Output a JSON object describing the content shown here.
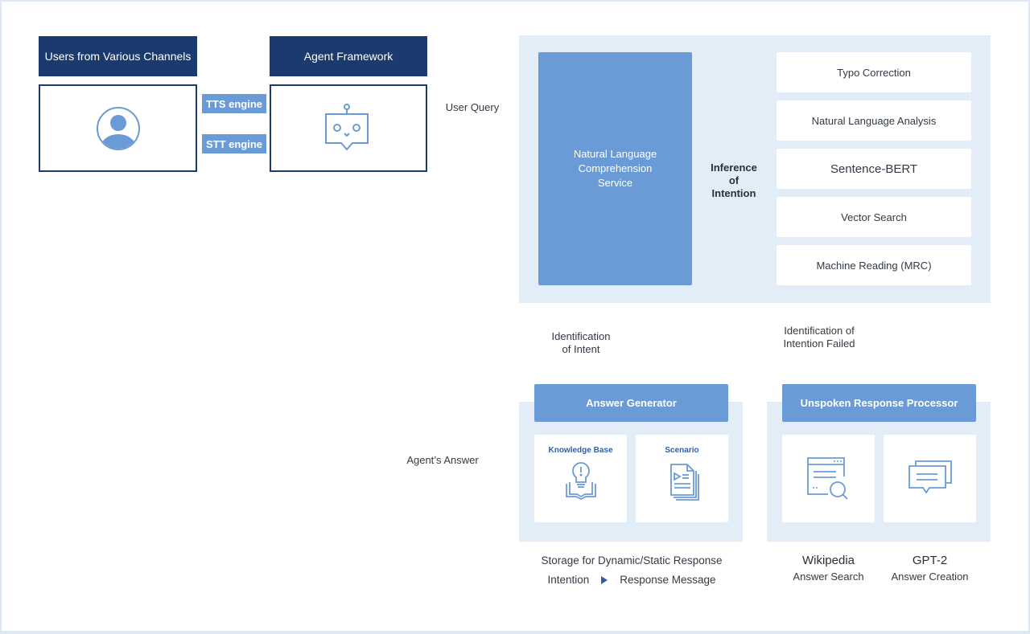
{
  "colors": {
    "navy": "#1b3a6e",
    "accent_blue": "#6a9bd6",
    "panel_bg": "#e3edf8",
    "card_title_blue": "#2f5ea8",
    "text": "#333a44"
  },
  "left": {
    "users_header": "Users from Various Channels",
    "users_icon": "user-avatar-icon",
    "agent_header": "Agent Framework",
    "agent_icon": "chatbot-icon",
    "engines": [
      "TTS engine",
      "STT engine"
    ]
  },
  "labels": {
    "user_query": "User Query",
    "agents_answer": "Agent’s Answer",
    "identification_of_intent": [
      "Identification",
      "of Intent"
    ],
    "identification_failed": [
      "Identification of",
      "Intention Failed"
    ]
  },
  "nlc": {
    "service": [
      "Natural Language",
      "Comprehension",
      "Service"
    ],
    "inference": [
      "Inference",
      "of",
      "Intention"
    ],
    "steps": [
      "Typo Correction",
      "Natural Language Analysis",
      "Sentence-BERT",
      "Vector Search",
      "Machine Reading (MRC)"
    ]
  },
  "answer_generator": {
    "title": "Answer Generator",
    "cards": [
      {
        "title": "Knowledge Base",
        "icon": "lightbulb-book-icon"
      },
      {
        "title": "Scenario",
        "icon": "scenario-document-icon"
      }
    ],
    "caption": "Storage for Dynamic/Static Response",
    "flow_from": "Intention",
    "flow_arrow_icon": "play-arrow-icon",
    "flow_to": "Response Message"
  },
  "unspoken_processor": {
    "title": "Unspoken Response Processor",
    "cards": [
      {
        "icon": "browser-search-icon",
        "name": "Wikipedia",
        "sub": "Answer Search"
      },
      {
        "icon": "chat-bubbles-icon",
        "name": "GPT-2",
        "sub": "Answer Creation"
      }
    ]
  }
}
